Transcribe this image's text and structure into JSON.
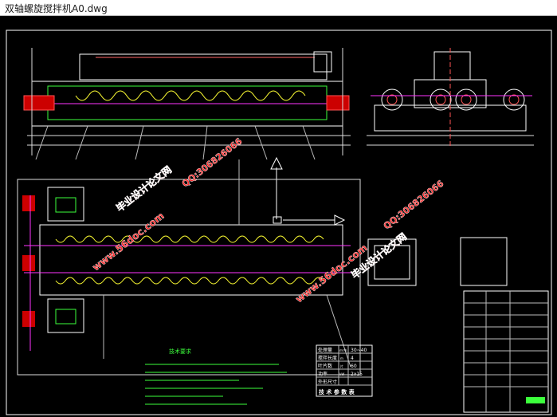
{
  "window": {
    "title": "双轴螺旋搅拌机A0.dwg"
  },
  "drawing": {
    "watermarks": [
      {
        "text": "www.56doc.com",
        "color": "#ff2a2a"
      },
      {
        "text": "毕业设计论文网",
        "color": "#ff2a2a"
      },
      {
        "text": "QQ:306826066",
        "color": "#ff2a2a"
      },
      {
        "text": "www.56doc.com",
        "color": "#ff2a2a"
      },
      {
        "text": "毕业设计论文网",
        "color": "#ff2a2a"
      },
      {
        "text": "QQ:306826066",
        "color": "#ff2a2a"
      }
    ],
    "tech_notes_title": "技术要求",
    "param_table": {
      "rows": [
        {
          "label": "处理量",
          "unit": "m³/h",
          "value": "30~40"
        },
        {
          "label": "搅拌长度",
          "unit": "m",
          "value": "4"
        },
        {
          "label": "叶片数",
          "unit": "片",
          "value": "60"
        },
        {
          "label": "功率",
          "unit": "kW",
          "value": "2x15"
        },
        {
          "label": "外形尺寸",
          "unit": "",
          "value": ""
        }
      ],
      "footer": "技 术 参 数 表"
    },
    "colors": {
      "frame": "#ffffff",
      "line_cyan": "#00e5ff",
      "line_green": "#3cff3c",
      "line_yellow": "#ffff33",
      "line_red": "#ff3333",
      "line_magenta": "#ff33ff"
    }
  }
}
